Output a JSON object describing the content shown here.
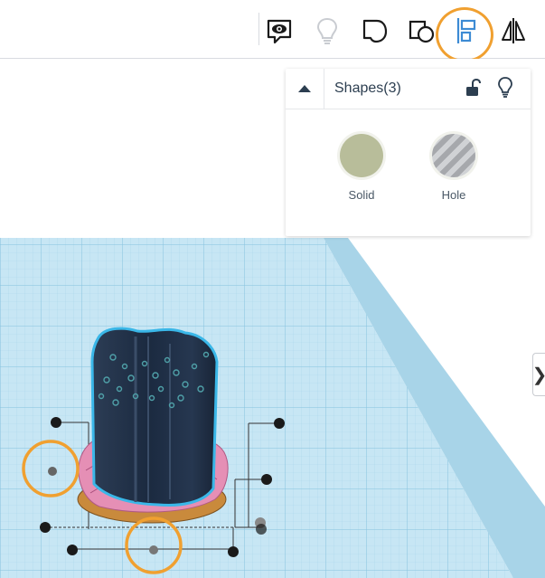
{
  "toolbar": {
    "buttons": [
      {
        "name": "notes",
        "icon": "speech-eye-icon",
        "active": true
      },
      {
        "name": "show-all",
        "icon": "lightbulb-icon",
        "active": false
      },
      {
        "name": "group",
        "icon": "shape-group-icon",
        "active": true
      },
      {
        "name": "ungroup",
        "icon": "shape-ungroup-icon",
        "active": true
      },
      {
        "name": "align",
        "icon": "align-icon",
        "active": true,
        "highlighted": true
      },
      {
        "name": "mirror",
        "icon": "mirror-icon",
        "active": true
      }
    ]
  },
  "shapes_panel": {
    "title": "Shapes(3)",
    "solid_label": "Solid",
    "hole_label": "Hole",
    "solid_color": "#b8bd9a",
    "collapse_icon": "triangle-up-icon",
    "lock_icon": "unlock-icon",
    "visibility_icon": "lightbulb-icon"
  },
  "side_tab": {
    "glyph": "❯"
  },
  "colors": {
    "accent": "#3d8bd4",
    "highlight": "#f0a030",
    "grid": "#bfe3f2",
    "object_dark": "#1e2e45",
    "object_pink": "#e58fb5",
    "object_base": "#c98a3c"
  }
}
